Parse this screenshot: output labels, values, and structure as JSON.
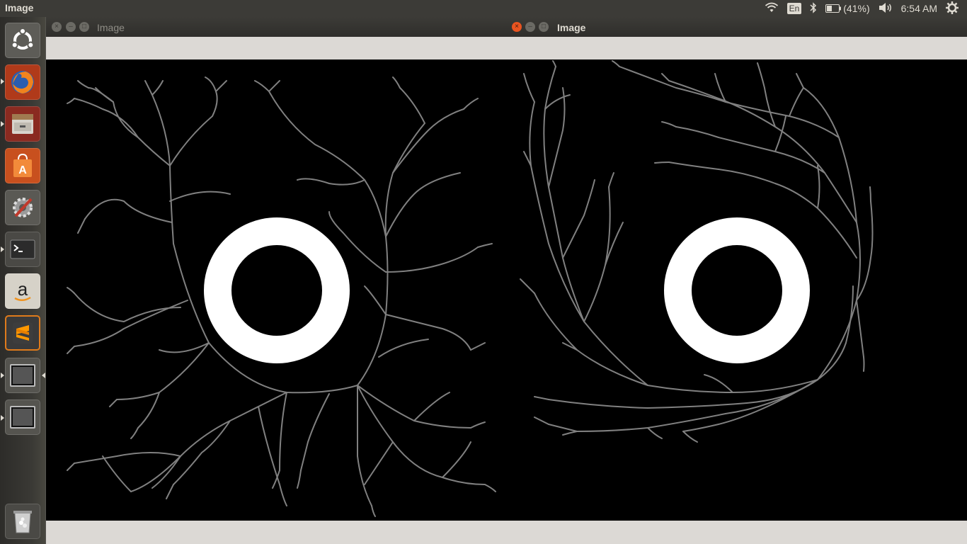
{
  "panel": {
    "app_title": "Image",
    "language": "En",
    "battery": "(41%)",
    "clock": "6:54 AM"
  },
  "launcher": {
    "items": [
      {
        "name": "ubuntu-dash",
        "icon": "ubuntu-logo-icon"
      },
      {
        "name": "firefox",
        "icon": "firefox-icon"
      },
      {
        "name": "files",
        "icon": "file-cabinet-icon"
      },
      {
        "name": "software-center",
        "icon": "shopping-bag-icon"
      },
      {
        "name": "system-settings",
        "icon": "gear-wrench-icon"
      },
      {
        "name": "terminal",
        "icon": "terminal-icon"
      },
      {
        "name": "amazon",
        "icon": "amazon-icon"
      },
      {
        "name": "sublime-text",
        "icon": "sublime-icon"
      },
      {
        "name": "image-window-1",
        "icon": "generic-window-icon"
      },
      {
        "name": "image-window-2",
        "icon": "generic-window-icon"
      },
      {
        "name": "trash",
        "icon": "trash-icon"
      }
    ]
  },
  "windows": [
    {
      "title": "Image",
      "active": false
    },
    {
      "title": "Image",
      "active": true
    }
  ],
  "colors": {
    "panel_bg": "#3c3b37",
    "accent": "#e95420",
    "canvas_bg": "#000000",
    "branch": "#808080",
    "ring": "#ffffff"
  }
}
